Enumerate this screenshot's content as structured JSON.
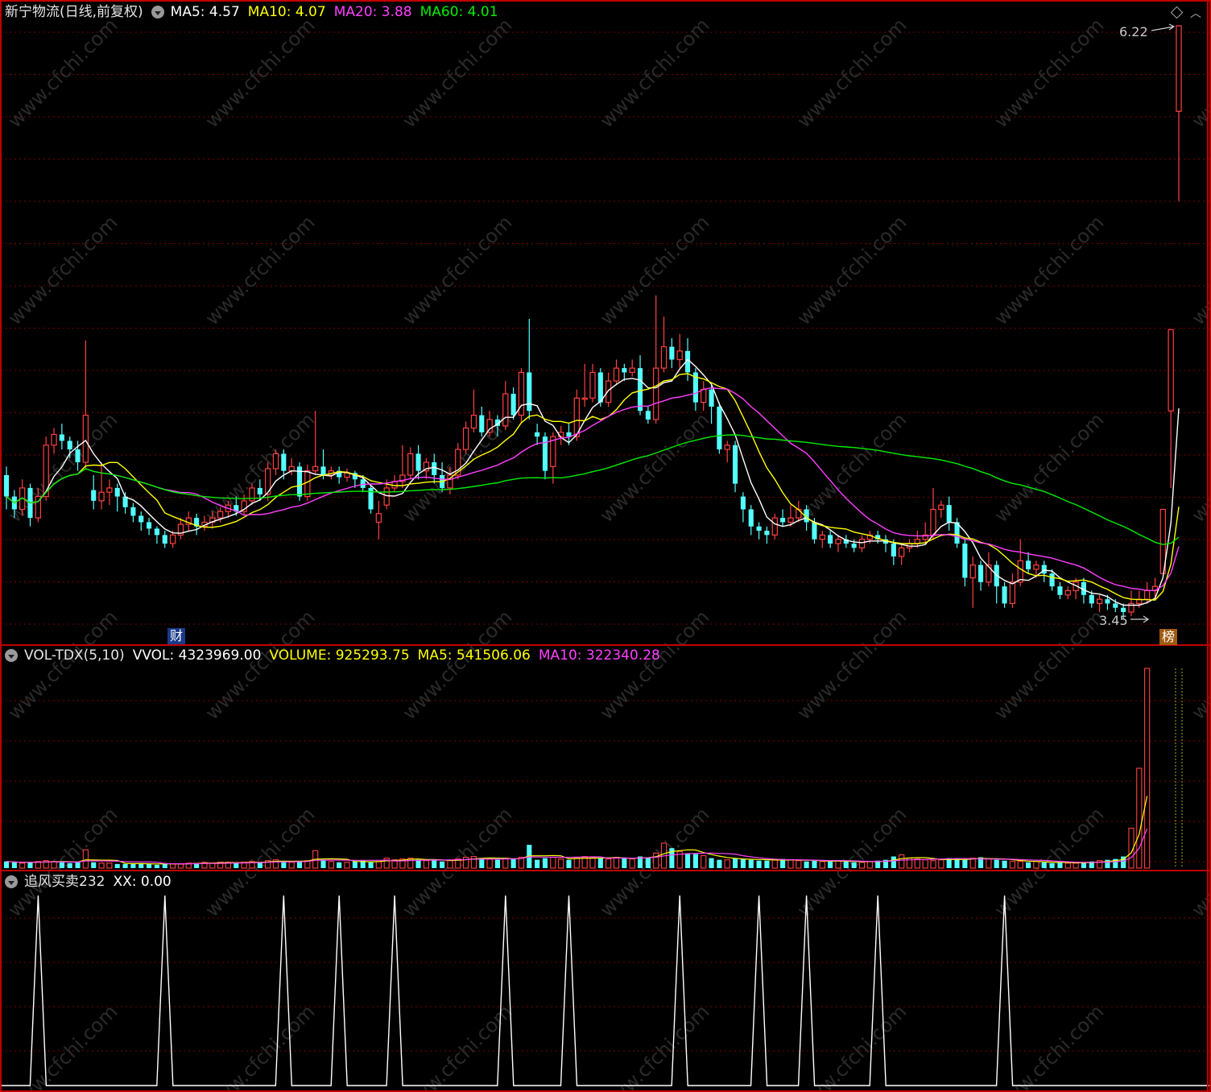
{
  "colors": {
    "up": "#ff4040",
    "down": "#54ffff",
    "ma5": "#ffffff",
    "ma10": "#ffff00",
    "ma20": "#ff40ff",
    "ma60": "#00ee00",
    "grid": "#800000",
    "border": "#c00000"
  },
  "main_panel": {
    "title": "新宁物流(日线,前复权)",
    "ma5_label": "MA5: 4.57",
    "ma10_label": "MA10: 4.07",
    "ma20_label": "MA20: 3.88",
    "ma60_label": "MA60: 4.01",
    "high_label": "6.22",
    "low_label": "3.45",
    "badge_finance": "财",
    "badge_rank": "榜"
  },
  "volume_panel": {
    "indicator": "VOL-TDX(5,10)",
    "vvol_label": "VVOL: 4323969.00",
    "volume_label": "VOLUME: 925293.75",
    "ma5_label": "MA5: 541506.06",
    "ma10_label": "MA10: 322340.28"
  },
  "indicator_panel": {
    "name": "追风买卖232",
    "xx_label": "XX: 0.00"
  },
  "chart_data": {
    "type": "candlestick",
    "price_range": [
      3.45,
      6.22
    ],
    "high": 6.22,
    "low": 3.45,
    "indicator_peaks_index": [
      4,
      20,
      35,
      42,
      49,
      63,
      71,
      85,
      95,
      101,
      110,
      126
    ],
    "candles": [
      {
        "o": 4.12,
        "c": 4.02,
        "h": 4.16,
        "l": 3.96
      },
      {
        "o": 4.02,
        "c": 3.96,
        "h": 4.05,
        "l": 3.92
      },
      {
        "o": 3.96,
        "c": 4.06,
        "h": 4.1,
        "l": 3.93
      },
      {
        "o": 4.06,
        "c": 3.92,
        "h": 4.08,
        "l": 3.88
      },
      {
        "o": 3.92,
        "c": 4.02,
        "h": 4.06,
        "l": 3.9
      },
      {
        "o": 4.02,
        "c": 4.26,
        "h": 4.3,
        "l": 4.0
      },
      {
        "o": 4.26,
        "c": 4.31,
        "h": 4.34,
        "l": 4.22
      },
      {
        "o": 4.31,
        "c": 4.28,
        "h": 4.36,
        "l": 4.24
      },
      {
        "o": 4.28,
        "c": 4.24,
        "h": 4.3,
        "l": 4.2
      },
      {
        "o": 4.24,
        "c": 4.18,
        "h": 4.28,
        "l": 4.14
      },
      {
        "o": 4.18,
        "c": 4.4,
        "h": 4.75,
        "l": 4.15
      },
      {
        "o": 4.05,
        "c": 4.0,
        "h": 4.12,
        "l": 3.96
      },
      {
        "o": 4.0,
        "c": 4.04,
        "h": 4.18,
        "l": 3.96
      },
      {
        "o": 4.04,
        "c": 4.06,
        "h": 4.1,
        "l": 3.98
      },
      {
        "o": 4.06,
        "c": 4.02,
        "h": 4.08,
        "l": 3.95
      },
      {
        "o": 4.02,
        "c": 3.97,
        "h": 4.04,
        "l": 3.94
      },
      {
        "o": 3.97,
        "c": 3.93,
        "h": 3.99,
        "l": 3.9
      },
      {
        "o": 3.93,
        "c": 3.9,
        "h": 3.95,
        "l": 3.86
      },
      {
        "o": 3.9,
        "c": 3.87,
        "h": 3.92,
        "l": 3.84
      },
      {
        "o": 3.87,
        "c": 3.84,
        "h": 3.88,
        "l": 3.8
      },
      {
        "o": 3.84,
        "c": 3.8,
        "h": 3.86,
        "l": 3.78
      },
      {
        "o": 3.8,
        "c": 3.84,
        "h": 3.86,
        "l": 3.78
      },
      {
        "o": 3.84,
        "c": 3.89,
        "h": 3.92,
        "l": 3.82
      },
      {
        "o": 3.89,
        "c": 3.92,
        "h": 3.95,
        "l": 3.86
      },
      {
        "o": 3.92,
        "c": 3.88,
        "h": 3.94,
        "l": 3.84
      },
      {
        "o": 3.88,
        "c": 3.9,
        "h": 3.93,
        "l": 3.86
      },
      {
        "o": 3.9,
        "c": 3.92,
        "h": 3.95,
        "l": 3.87
      },
      {
        "o": 3.92,
        "c": 3.95,
        "h": 3.97,
        "l": 3.9
      },
      {
        "o": 3.95,
        "c": 3.98,
        "h": 4.0,
        "l": 3.92
      },
      {
        "o": 3.98,
        "c": 3.95,
        "h": 4.02,
        "l": 3.93
      },
      {
        "o": 3.95,
        "c": 4.0,
        "h": 4.03,
        "l": 3.93
      },
      {
        "o": 4.0,
        "c": 4.06,
        "h": 4.08,
        "l": 3.98
      },
      {
        "o": 4.06,
        "c": 4.03,
        "h": 4.1,
        "l": 4.0
      },
      {
        "o": 4.03,
        "c": 4.15,
        "h": 4.18,
        "l": 4.0
      },
      {
        "o": 4.15,
        "c": 4.22,
        "h": 4.24,
        "l": 4.12
      },
      {
        "o": 4.22,
        "c": 4.14,
        "h": 4.24,
        "l": 4.1
      },
      {
        "o": 4.14,
        "c": 4.16,
        "h": 4.2,
        "l": 4.12
      },
      {
        "o": 4.16,
        "c": 4.02,
        "h": 4.18,
        "l": 4.0
      },
      {
        "o": 4.02,
        "c": 4.14,
        "h": 4.17,
        "l": 4.0
      },
      {
        "o": 4.14,
        "c": 4.16,
        "h": 4.42,
        "l": 4.12
      },
      {
        "o": 4.16,
        "c": 4.12,
        "h": 4.24,
        "l": 4.1
      },
      {
        "o": 4.12,
        "c": 4.14,
        "h": 4.16,
        "l": 4.1
      },
      {
        "o": 4.14,
        "c": 4.11,
        "h": 4.16,
        "l": 4.08
      },
      {
        "o": 4.11,
        "c": 4.13,
        "h": 4.15,
        "l": 4.09
      },
      {
        "o": 4.13,
        "c": 4.1,
        "h": 4.14,
        "l": 4.06
      },
      {
        "o": 4.1,
        "c": 4.06,
        "h": 4.12,
        "l": 4.04
      },
      {
        "o": 4.06,
        "c": 3.96,
        "h": 4.08,
        "l": 3.94
      },
      {
        "o": 3.9,
        "c": 3.94,
        "h": 4.0,
        "l": 3.82
      },
      {
        "o": 3.98,
        "c": 4.06,
        "h": 4.1,
        "l": 3.96
      },
      {
        "o": 4.06,
        "c": 4.09,
        "h": 4.12,
        "l": 4.04
      },
      {
        "o": 4.09,
        "c": 4.12,
        "h": 4.26,
        "l": 4.06
      },
      {
        "o": 4.12,
        "c": 4.22,
        "h": 4.25,
        "l": 4.1
      },
      {
        "o": 4.22,
        "c": 4.14,
        "h": 4.26,
        "l": 4.1
      },
      {
        "o": 4.14,
        "c": 4.18,
        "h": 4.2,
        "l": 4.1
      },
      {
        "o": 4.18,
        "c": 4.12,
        "h": 4.22,
        "l": 4.08
      },
      {
        "o": 4.12,
        "c": 4.06,
        "h": 4.18,
        "l": 4.04
      },
      {
        "o": 4.06,
        "c": 4.12,
        "h": 4.16,
        "l": 4.03
      },
      {
        "o": 4.12,
        "c": 4.24,
        "h": 4.27,
        "l": 4.1
      },
      {
        "o": 4.24,
        "c": 4.34,
        "h": 4.37,
        "l": 4.22
      },
      {
        "o": 4.34,
        "c": 4.4,
        "h": 4.52,
        "l": 4.32
      },
      {
        "o": 4.4,
        "c": 4.32,
        "h": 4.44,
        "l": 4.3
      },
      {
        "o": 4.32,
        "c": 4.38,
        "h": 4.42,
        "l": 4.3
      },
      {
        "o": 4.38,
        "c": 4.35,
        "h": 4.4,
        "l": 4.3
      },
      {
        "o": 4.35,
        "c": 4.5,
        "h": 4.56,
        "l": 4.33
      },
      {
        "o": 4.5,
        "c": 4.4,
        "h": 4.53,
        "l": 4.38
      },
      {
        "o": 4.4,
        "c": 4.6,
        "h": 4.62,
        "l": 4.36
      },
      {
        "o": 4.6,
        "c": 4.42,
        "h": 4.85,
        "l": 4.38
      },
      {
        "o": 4.32,
        "c": 4.3,
        "h": 4.36,
        "l": 4.26
      },
      {
        "o": 4.3,
        "c": 4.14,
        "h": 4.32,
        "l": 4.1
      },
      {
        "o": 4.16,
        "c": 4.3,
        "h": 4.32,
        "l": 4.08
      },
      {
        "o": 4.3,
        "c": 4.32,
        "h": 4.35,
        "l": 4.26
      },
      {
        "o": 4.32,
        "c": 4.3,
        "h": 4.36,
        "l": 4.26
      },
      {
        "o": 4.3,
        "c": 4.48,
        "h": 4.52,
        "l": 4.28
      },
      {
        "o": 4.48,
        "c": 4.48,
        "h": 4.64,
        "l": 4.44
      },
      {
        "o": 4.48,
        "c": 4.6,
        "h": 4.64,
        "l": 4.46
      },
      {
        "o": 4.6,
        "c": 4.46,
        "h": 4.62,
        "l": 4.44
      },
      {
        "o": 4.46,
        "c": 4.56,
        "h": 4.6,
        "l": 4.44
      },
      {
        "o": 4.56,
        "c": 4.62,
        "h": 4.66,
        "l": 4.54
      },
      {
        "o": 4.62,
        "c": 4.6,
        "h": 4.64,
        "l": 4.56
      },
      {
        "o": 4.6,
        "c": 4.62,
        "h": 4.66,
        "l": 4.58
      },
      {
        "o": 4.62,
        "c": 4.42,
        "h": 4.68,
        "l": 4.4
      },
      {
        "o": 4.42,
        "c": 4.38,
        "h": 4.44,
        "l": 4.36
      },
      {
        "o": 4.38,
        "c": 4.62,
        "h": 4.96,
        "l": 4.36
      },
      {
        "o": 4.62,
        "c": 4.72,
        "h": 4.86,
        "l": 4.6
      },
      {
        "o": 4.72,
        "c": 4.66,
        "h": 4.76,
        "l": 4.62
      },
      {
        "o": 4.66,
        "c": 4.7,
        "h": 4.78,
        "l": 4.62
      },
      {
        "o": 4.7,
        "c": 4.6,
        "h": 4.76,
        "l": 4.56
      },
      {
        "o": 4.6,
        "c": 4.46,
        "h": 4.62,
        "l": 4.42
      },
      {
        "o": 4.46,
        "c": 4.52,
        "h": 4.56,
        "l": 4.42
      },
      {
        "o": 4.52,
        "c": 4.44,
        "h": 4.54,
        "l": 4.36
      },
      {
        "o": 4.44,
        "c": 4.24,
        "h": 4.46,
        "l": 4.22
      },
      {
        "o": 4.24,
        "c": 4.26,
        "h": 4.28,
        "l": 4.18
      },
      {
        "o": 4.26,
        "c": 4.08,
        "h": 4.28,
        "l": 4.04
      },
      {
        "o": 4.02,
        "c": 3.96,
        "h": 4.04,
        "l": 3.9
      },
      {
        "o": 3.96,
        "c": 3.88,
        "h": 3.98,
        "l": 3.84
      },
      {
        "o": 3.88,
        "c": 3.86,
        "h": 3.9,
        "l": 3.82
      },
      {
        "o": 3.86,
        "c": 3.84,
        "h": 3.88,
        "l": 3.8
      },
      {
        "o": 3.84,
        "c": 3.92,
        "h": 3.94,
        "l": 3.82
      },
      {
        "o": 3.92,
        "c": 3.9,
        "h": 3.96,
        "l": 3.88
      },
      {
        "o": 3.9,
        "c": 3.92,
        "h": 3.98,
        "l": 3.88
      },
      {
        "o": 3.92,
        "c": 3.96,
        "h": 4.0,
        "l": 3.9
      },
      {
        "o": 3.96,
        "c": 3.9,
        "h": 3.98,
        "l": 3.86
      },
      {
        "o": 3.9,
        "c": 3.82,
        "h": 3.92,
        "l": 3.8
      },
      {
        "o": 3.82,
        "c": 3.84,
        "h": 3.86,
        "l": 3.78
      },
      {
        "o": 3.84,
        "c": 3.8,
        "h": 3.86,
        "l": 3.78
      },
      {
        "o": 3.8,
        "c": 3.82,
        "h": 3.84,
        "l": 3.76
      },
      {
        "o": 3.82,
        "c": 3.8,
        "h": 3.84,
        "l": 3.78
      },
      {
        "o": 3.8,
        "c": 3.78,
        "h": 3.82,
        "l": 3.76
      },
      {
        "o": 3.78,
        "c": 3.82,
        "h": 3.84,
        "l": 3.76
      },
      {
        "o": 3.82,
        "c": 3.84,
        "h": 3.86,
        "l": 3.8
      },
      {
        "o": 3.84,
        "c": 3.82,
        "h": 3.86,
        "l": 3.8
      },
      {
        "o": 3.82,
        "c": 3.8,
        "h": 3.84,
        "l": 3.76
      },
      {
        "o": 3.8,
        "c": 3.74,
        "h": 3.82,
        "l": 3.7
      },
      {
        "o": 3.74,
        "c": 3.78,
        "h": 3.8,
        "l": 3.7
      },
      {
        "o": 3.78,
        "c": 3.8,
        "h": 3.82,
        "l": 3.76
      },
      {
        "o": 3.8,
        "c": 3.82,
        "h": 3.86,
        "l": 3.78
      },
      {
        "o": 3.82,
        "c": 3.84,
        "h": 3.9,
        "l": 3.8
      },
      {
        "o": 3.84,
        "c": 3.96,
        "h": 4.06,
        "l": 3.82
      },
      {
        "o": 3.96,
        "c": 3.98,
        "h": 4.0,
        "l": 3.92
      },
      {
        "o": 3.98,
        "c": 3.9,
        "h": 4.02,
        "l": 3.86
      },
      {
        "o": 3.9,
        "c": 3.8,
        "h": 3.92,
        "l": 3.78
      },
      {
        "o": 3.8,
        "c": 3.64,
        "h": 3.82,
        "l": 3.6
      },
      {
        "o": 3.64,
        "c": 3.7,
        "h": 3.74,
        "l": 3.5
      },
      {
        "o": 3.7,
        "c": 3.62,
        "h": 3.72,
        "l": 3.58
      },
      {
        "o": 3.62,
        "c": 3.7,
        "h": 3.76,
        "l": 3.6
      },
      {
        "o": 3.7,
        "c": 3.6,
        "h": 3.72,
        "l": 3.52
      },
      {
        "o": 3.6,
        "c": 3.52,
        "h": 3.62,
        "l": 3.5
      },
      {
        "o": 3.52,
        "c": 3.62,
        "h": 3.66,
        "l": 3.5
      },
      {
        "o": 3.62,
        "c": 3.72,
        "h": 3.82,
        "l": 3.6
      },
      {
        "o": 3.72,
        "c": 3.68,
        "h": 3.76,
        "l": 3.66
      },
      {
        "o": 3.68,
        "c": 3.7,
        "h": 3.72,
        "l": 3.64
      },
      {
        "o": 3.7,
        "c": 3.66,
        "h": 3.72,
        "l": 3.62
      },
      {
        "o": 3.66,
        "c": 3.6,
        "h": 3.68,
        "l": 3.58
      },
      {
        "o": 3.6,
        "c": 3.56,
        "h": 3.62,
        "l": 3.54
      },
      {
        "o": 3.56,
        "c": 3.58,
        "h": 3.6,
        "l": 3.54
      },
      {
        "o": 3.58,
        "c": 3.62,
        "h": 3.64,
        "l": 3.54
      },
      {
        "o": 3.62,
        "c": 3.56,
        "h": 3.64,
        "l": 3.52
      },
      {
        "o": 3.56,
        "c": 3.52,
        "h": 3.58,
        "l": 3.5
      },
      {
        "o": 3.52,
        "c": 3.54,
        "h": 3.56,
        "l": 3.48
      },
      {
        "o": 3.54,
        "c": 3.52,
        "h": 3.56,
        "l": 3.49
      },
      {
        "o": 3.52,
        "c": 3.5,
        "h": 3.54,
        "l": 3.48
      },
      {
        "o": 3.5,
        "c": 3.48,
        "h": 3.52,
        "l": 3.45
      },
      {
        "o": 3.48,
        "c": 3.52,
        "h": 3.58,
        "l": 3.46
      },
      {
        "o": 3.52,
        "c": 3.54,
        "h": 3.58,
        "l": 3.5
      },
      {
        "o": 3.54,
        "c": 3.58,
        "h": 3.62,
        "l": 3.52
      },
      {
        "o": 3.58,
        "c": 3.6,
        "h": 3.64,
        "l": 3.54
      },
      {
        "o": 3.66,
        "c": 3.96,
        "h": 3.96,
        "l": 3.66
      },
      {
        "o": 4.42,
        "c": 4.8,
        "h": 4.8,
        "l": 4.06
      },
      {
        "o": 5.82,
        "c": 6.22,
        "h": 6.22,
        "l": 5.4
      }
    ],
    "volumes": [
      8,
      7,
      6,
      7,
      8,
      9,
      8,
      7,
      6,
      7,
      22,
      7,
      6,
      6,
      5,
      5,
      5,
      6,
      5,
      4,
      6,
      5,
      5,
      6,
      6,
      7,
      6,
      7,
      7,
      6,
      7,
      8,
      7,
      9,
      10,
      8,
      7,
      8,
      9,
      21,
      10,
      8,
      7,
      7,
      8,
      9,
      7,
      8,
      12,
      10,
      11,
      12,
      10,
      9,
      10,
      8,
      9,
      11,
      13,
      14,
      12,
      11,
      10,
      12,
      11,
      13,
      28,
      10,
      12,
      13,
      11,
      10,
      12,
      14,
      13,
      12,
      11,
      13,
      12,
      11,
      14,
      13,
      18,
      30,
      24,
      20,
      18,
      17,
      15,
      12,
      10,
      10,
      12,
      11,
      10,
      9,
      9,
      10,
      11,
      10,
      9,
      8,
      9,
      8,
      8,
      9,
      8,
      7,
      7,
      8,
      9,
      10,
      14,
      16,
      12,
      11,
      10,
      9,
      10,
      12,
      11,
      10,
      12,
      13,
      11,
      10,
      9,
      8,
      8,
      7,
      8,
      7,
      6,
      7,
      6,
      6,
      7,
      8,
      9,
      10,
      11,
      14,
      48,
      120,
      240
    ]
  }
}
